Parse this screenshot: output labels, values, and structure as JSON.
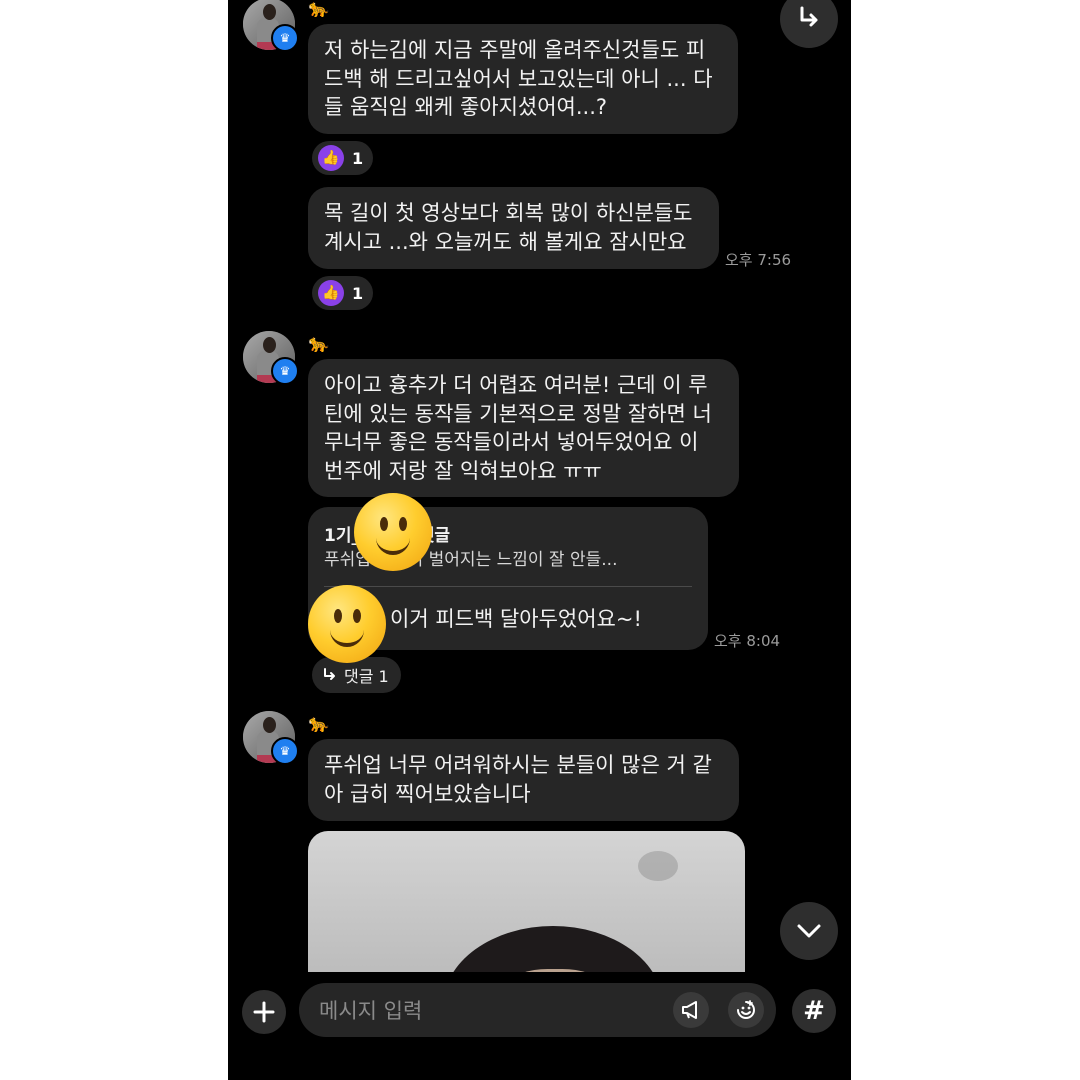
{
  "messages": [
    {
      "sender_icon": "🐆",
      "text": "저 하는김에 지금 주말에 올려주신것들도 피\n드백 해 드리고싶어서 보고있는데 아니 ... 다\n들 움직임 왜케 좋아지셨어여...?",
      "reaction_count": "1"
    },
    {
      "text": "목 길이 첫 영상보다 회복 많이 하신분들도\n계시고 ...와 오늘꺼도 해 볼게요 잠시만요",
      "time": "오후 7:56",
      "reaction_count": "1"
    },
    {
      "sender_icon": "🐆",
      "text": "아이고 흉추가 더 어렵죠 여러분! 근데 이 루\n틴에 있는 동작들 기본적으로 정말 잘하면 너\n무너무 좋은 동작들이라서 넣어두었어요 이\n번주에 저랑 잘 익혀보아요 ㅠㅠ"
    },
    {
      "reply_title": "1기_ 님에게 댓글",
      "reply_quote": "푸쉬업 가슴이 벌어지는 느낌이 잘 안들...",
      "reply_body": "이거 피드백 달아두었어요~!",
      "time": "오후 8:04",
      "thread_label": "댓글 1"
    },
    {
      "sender_icon": "🐆",
      "text": "푸쉬업 너무 어려워하시는 분들이 많은 거 같\n아 급히 찍어보았습니다"
    }
  ],
  "composer": {
    "placeholder": "메시지 입력"
  },
  "colors": {
    "background": "#000000",
    "bubble": "#262626",
    "like_badge": "#8a41e8",
    "crown_badge": "#1f7ff0",
    "timestamp": "#9b9b9b"
  }
}
